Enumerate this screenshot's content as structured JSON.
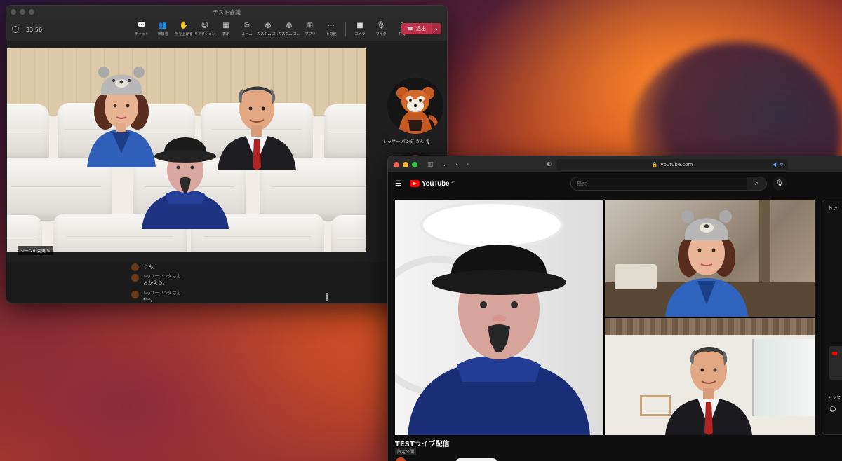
{
  "teams": {
    "window_title": "テスト会議",
    "timer": "33:56",
    "toolbar": [
      {
        "label": "チャット",
        "icon": "chat-icon",
        "glyph": "💬"
      },
      {
        "label": "参加者",
        "icon": "people-icon",
        "glyph": "👥"
      },
      {
        "label": "手を上げる",
        "icon": "raise-hand-icon",
        "glyph": "✋"
      },
      {
        "label": "リアクション",
        "icon": "reaction-icon",
        "glyph": "☺"
      },
      {
        "label": "表示",
        "icon": "view-icon",
        "glyph": "▦"
      },
      {
        "label": "ルーム",
        "icon": "rooms-icon",
        "glyph": "⧉"
      },
      {
        "label": "カスタム ス...",
        "icon": "globe-icon",
        "glyph": "◍"
      },
      {
        "label": "カスタム ス...",
        "icon": "globe-icon",
        "glyph": "◍"
      },
      {
        "label": "アプリ",
        "icon": "apps-icon",
        "glyph": "⊞"
      },
      {
        "label": "その他",
        "icon": "more-icon",
        "glyph": "⋯"
      }
    ],
    "media_controls": [
      {
        "label": "カメラ",
        "icon": "camera-icon",
        "glyph": "■"
      },
      {
        "label": "マイク",
        "icon": "mic-icon",
        "glyph": "🎙"
      },
      {
        "label": "共有",
        "icon": "share-icon",
        "glyph": "⇧"
      }
    ],
    "leave_label": "退出",
    "scene_label": "シーンの変更",
    "participant_name": "レッサー パンダ さん",
    "chat": [
      {
        "sender": "",
        "message": "うん。"
      },
      {
        "sender": "レッサー パンダ さん",
        "message": "おかえり。"
      },
      {
        "sender": "レッサー パンダ さん",
        "message": "***。"
      }
    ]
  },
  "safari": {
    "url": "youtube.com"
  },
  "youtube": {
    "logo_text": "YouTube",
    "logo_suffix": "JP",
    "search_placeholder": "検索",
    "video_title": "TESTライブ配信",
    "visibility_badge": "限定公開",
    "right_panel_title": "トッ",
    "right_panel_msg": "メッセ"
  },
  "colors": {
    "leave_red": "#c4314b",
    "youtube_red": "#ff0000"
  }
}
